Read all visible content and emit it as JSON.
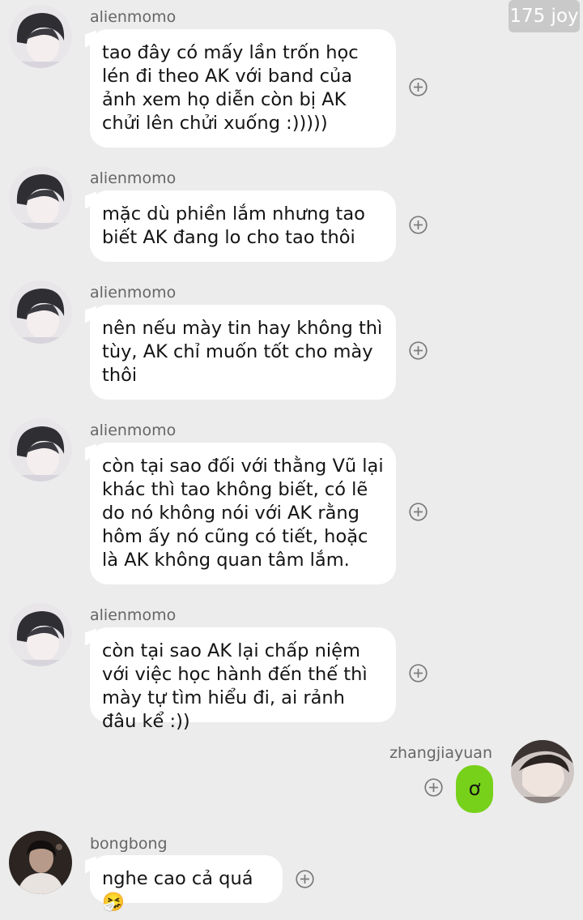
{
  "watermark": {
    "text": "175 joy"
  },
  "messages": [
    {
      "sender": "alienmomo",
      "avatar_icon": "avatar-boy-photo",
      "text": "tao đây có mấy lần trốn học lén đi theo AK với band của ảnh xem họ diễn còn bị AK chửi lên chửi xuống :)))))"
    },
    {
      "sender": "alienmomo",
      "avatar_icon": "avatar-boy-photo",
      "text": "mặc dù phiền lắm nhưng tao biết AK đang lo cho tao thôi"
    },
    {
      "sender": "alienmomo",
      "avatar_icon": "avatar-boy-photo",
      "text": "nên nếu mày tin hay không thì tùy, AK chỉ muốn tốt cho mày thôi"
    },
    {
      "sender": "alienmomo",
      "avatar_icon": "avatar-boy-photo",
      "text": "còn tại sao đối với thằng Vũ lại khác thì tao không biết, có lẽ do nó không nói với AK rằng hôm ấy nó cũng có tiết, hoặc là AK không quan tâm lắm."
    },
    {
      "sender": "alienmomo",
      "avatar_icon": "avatar-boy-photo",
      "text": "còn tại sao AK lại chấp niệm với việc học hành đến thế thì mày tự tìm hiểu đi, ai rảnh đâu kể :))"
    },
    {
      "sender": "zhangjiayuan",
      "avatar_icon": "avatar-side-profile-photo",
      "text": "ơ"
    },
    {
      "sender": "bongbong",
      "avatar_icon": "avatar-dark-photo",
      "text": "nghe cao cả quá 🤧"
    }
  ],
  "colors": {
    "background": "#ececec",
    "bubble_incoming": "#ffffff",
    "bubble_outgoing": "#77d11a",
    "name_text": "#666666",
    "plus_icon": "#7a7a7a"
  },
  "icons": {
    "react": "plus-circle-icon"
  }
}
